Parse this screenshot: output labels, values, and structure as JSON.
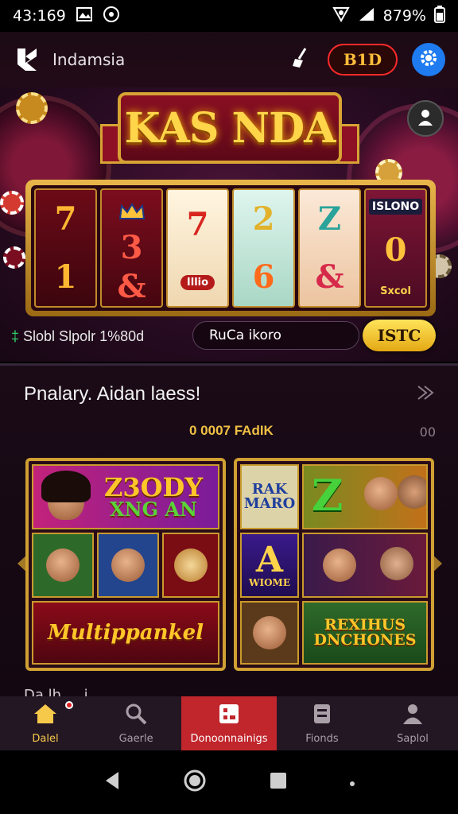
{
  "status_bar": {
    "time": "43:169",
    "battery": "879%",
    "icons": [
      "image-icon",
      "target-icon",
      "vpn-icon",
      "signal-icon",
      "battery-icon"
    ]
  },
  "header": {
    "app_name": "Indamsia",
    "balance_label": "B1D",
    "icons": [
      "app-logo-icon",
      "broom-icon",
      "gear-icon"
    ]
  },
  "hero": {
    "banner_title": "KAS NDA",
    "reels": [
      {
        "top": "7",
        "bottom": "1"
      },
      {
        "tag": "",
        "top": "3",
        "bottom": "&"
      },
      {
        "top": "7",
        "bottom": "Illio"
      },
      {
        "top": "2",
        "bottom": "6"
      },
      {
        "top": "Z",
        "bottom": "&"
      },
      {
        "tag": "ISLONO",
        "top": "0",
        "bottom": "Sxcol"
      }
    ],
    "slot_prefix": "‡",
    "slot_label": "Slobl Slpolr 1%80d",
    "code_value": "RuCa ikoro",
    "action_button": "ISTC"
  },
  "section": {
    "title": "Pnalary. Aidan laess!",
    "subtitle": "0 0007 FAdIK",
    "right_meta": "00",
    "peek_text": "Da lh ... i"
  },
  "cards": [
    {
      "top_text": "Z3ODY",
      "top_text2": "XNG AN",
      "bottom_text": "Multippankel"
    },
    {
      "cell1": "RAK MARO",
      "cell2": "Z",
      "cell3": "A",
      "cell3_sub": "WIOME",
      "bottom_text": "REXIHUS DNCHONES"
    }
  ],
  "bottom_nav": [
    {
      "label": "Dalel",
      "icon": "home-icon"
    },
    {
      "label": "Gaerle",
      "icon": "search-icon"
    },
    {
      "label": "Donoonnainigs",
      "icon": "grid-icon"
    },
    {
      "label": "Fionds",
      "icon": "document-icon"
    },
    {
      "label": "Saplol",
      "icon": "profile-icon"
    }
  ],
  "colors": {
    "accent_gold": "#f6c94a",
    "accent_red": "#c0262c",
    "settings_blue": "#1e7bf0",
    "background": "#170713"
  }
}
